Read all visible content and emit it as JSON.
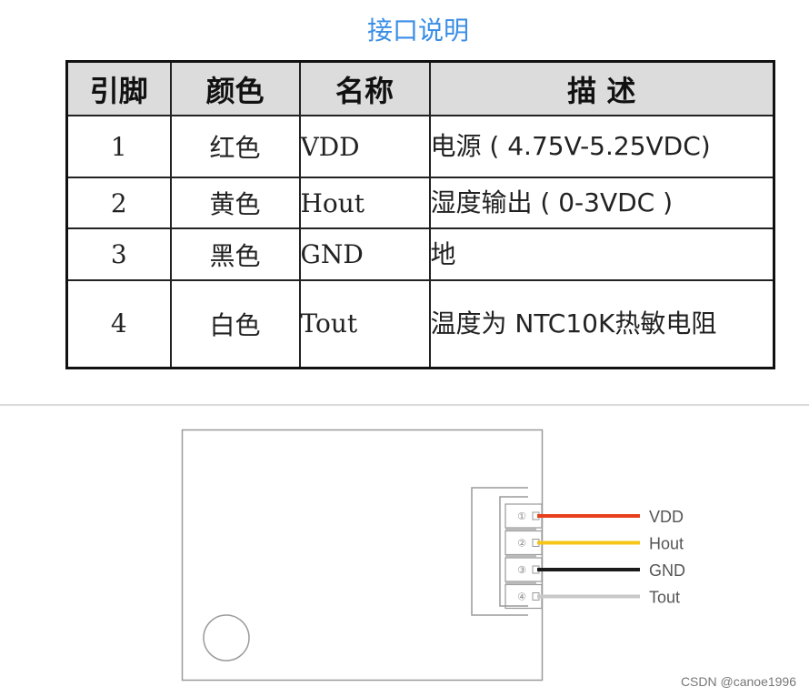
{
  "title": "接口说明",
  "table": {
    "headers": [
      "引脚",
      "颜色",
      "名称",
      "描 述"
    ],
    "rows": [
      {
        "pin": "1",
        "color": "红色",
        "name": "VDD",
        "description": "电源 ( 4.75V-5.25VDC)"
      },
      {
        "pin": "2",
        "color": "黄色",
        "name": "Hout",
        "description": "湿度输出 ( 0-3VDC )"
      },
      {
        "pin": "3",
        "color": "黑色",
        "name": "GND",
        "description": "地"
      },
      {
        "pin": "4",
        "color": "白色",
        "name": "Tout",
        "description": "温度为 NTC10K热敏电阻"
      }
    ]
  },
  "diagram": {
    "connector_pins": [
      {
        "marker": "①",
        "label": "VDD",
        "wire_color": "#e8401c"
      },
      {
        "marker": "②",
        "label": "Hout",
        "wire_color": "#f5c518"
      },
      {
        "marker": "③",
        "label": "GND",
        "wire_color": "#1a1a1a"
      },
      {
        "marker": "④",
        "label": "Tout",
        "wire_color": "#c8c8c8"
      }
    ],
    "outline_color": "#9a9a9a",
    "label_color": "#555555"
  },
  "watermark": "CSDN @canoe1996"
}
